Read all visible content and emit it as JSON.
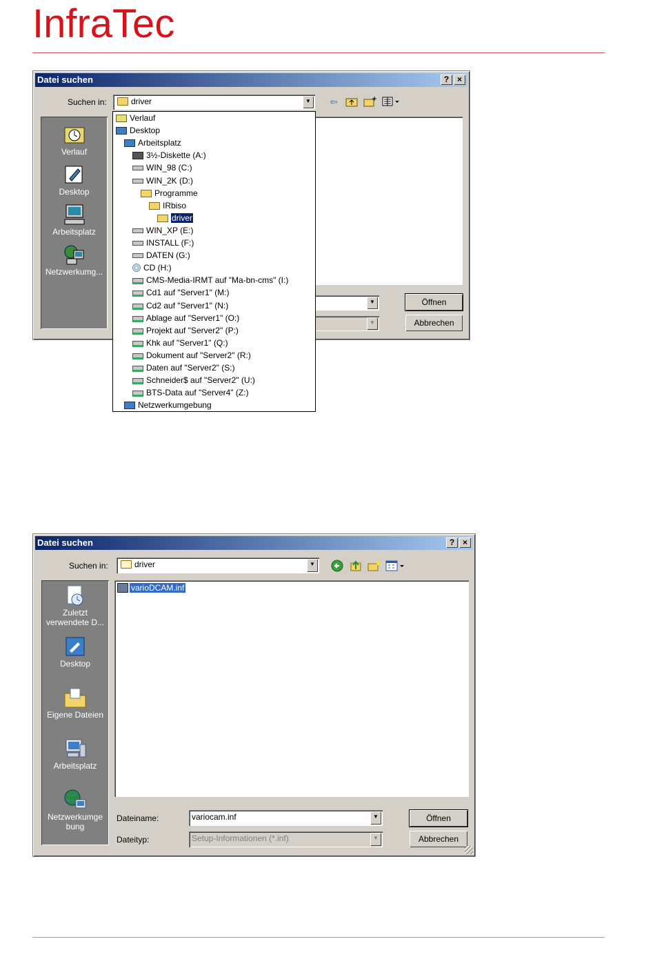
{
  "logo": {
    "text": "InfraTec"
  },
  "dialog1": {
    "title": "Datei suchen",
    "help_btn": "?",
    "close_btn": "×",
    "look_in_label": "Suchen in:",
    "look_in_value": "driver",
    "places": [
      "Verlauf",
      "Desktop",
      "Arbeitsplatz",
      "Netzwerkumg..."
    ],
    "open_btn": "Öffnen",
    "cancel_btn": "Abbrechen",
    "dropdown": [
      {
        "label": "Verlauf",
        "icon": "history-icon"
      },
      {
        "label": "Desktop",
        "icon": "desktop-icon"
      },
      {
        "label": "Arbeitsplatz",
        "icon": "computer-icon"
      },
      {
        "label": "3½-Diskette (A:)",
        "icon": "floppy-icon"
      },
      {
        "label": "WIN_98 (C:)",
        "icon": "drive-icon"
      },
      {
        "label": "WIN_2K (D:)",
        "icon": "drive-icon"
      },
      {
        "label": "Programme",
        "icon": "folder-icon"
      },
      {
        "label": "IRbiso",
        "icon": "folder-icon"
      },
      {
        "label": "driver",
        "icon": "folder-icon"
      },
      {
        "label": "WIN_XP (E:)",
        "icon": "drive-icon"
      },
      {
        "label": "INSTALL (F:)",
        "icon": "drive-icon"
      },
      {
        "label": "DATEN (G:)",
        "icon": "drive-icon"
      },
      {
        "label": "CD (H:)",
        "icon": "cd-icon"
      },
      {
        "label": "CMS-Media-IRMT auf \"Ma-bn-cms\" (I:)",
        "icon": "network-drive-icon"
      },
      {
        "label": "Cd1 auf \"Server1\" (M:)",
        "icon": "network-drive-icon"
      },
      {
        "label": "Cd2 auf \"Server1\" (N:)",
        "icon": "network-drive-icon"
      },
      {
        "label": "Ablage auf \"Server1\" (O:)",
        "icon": "network-drive-icon"
      },
      {
        "label": "Projekt auf \"Server2\" (P:)",
        "icon": "network-drive-icon"
      },
      {
        "label": "Khk auf \"Server1\" (Q:)",
        "icon": "network-drive-icon"
      },
      {
        "label": "Dokument auf \"Server2\" (R:)",
        "icon": "network-drive-icon"
      },
      {
        "label": "Daten auf \"Server2\" (S:)",
        "icon": "network-drive-icon"
      },
      {
        "label": "Schneider$ auf \"Server2\" (U:)",
        "icon": "network-drive-icon"
      },
      {
        "label": "BTS-Data auf \"Server4\" (Z:)",
        "icon": "network-drive-icon"
      },
      {
        "label": "Netzwerkumgebung",
        "icon": "network-icon"
      }
    ]
  },
  "dialog2": {
    "title": "Datei suchen",
    "help_btn": "?",
    "close_btn": "×",
    "look_in_label": "Suchen in:",
    "look_in_value": "driver",
    "places": [
      "Zuletzt verwendete D...",
      "Desktop",
      "Eigene Dateien",
      "Arbeitsplatz",
      "Netzwerkumge bung"
    ],
    "file": "varioDCAM.inf",
    "filename_label": "Dateiname:",
    "filename_value": "variocam.inf",
    "filetype_label": "Dateityp:",
    "filetype_value": "Setup-Informationen (*.inf)",
    "open_btn": "Öffnen",
    "cancel_btn": "Abbrechen"
  }
}
